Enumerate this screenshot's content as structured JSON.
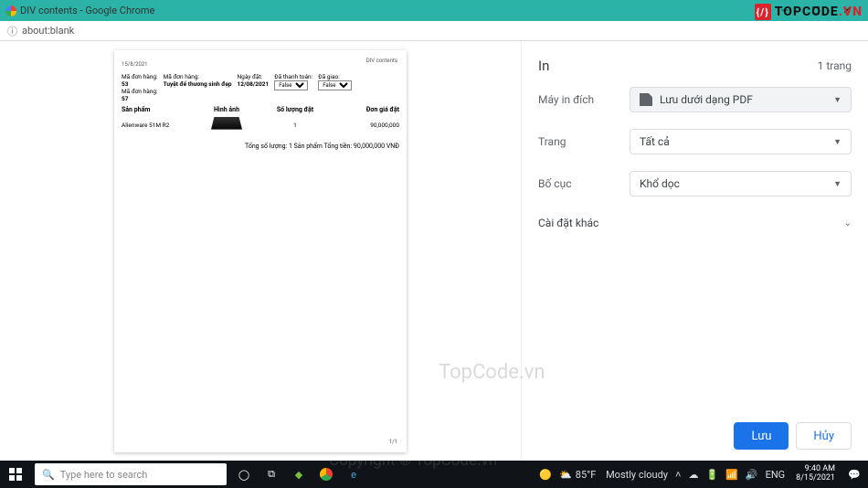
{
  "window": {
    "title": "DIV contents - Google Chrome"
  },
  "addr": {
    "url": "about:blank"
  },
  "logo": {
    "mark": "{/}",
    "a": "TOPCODE",
    "b": ".VN"
  },
  "bg": {
    "line1a": "Mã đơn hàng: ",
    "id1": "53",
    "line1b": " Mã đơn hàng: ",
    "id2": "57",
    "tail": " N",
    "line2": "Sản phẩm",
    "product": "Alienware 51M R2"
  },
  "doc": {
    "topdate": "15/8/2021",
    "corner": "DIV contents",
    "c1l": "Mã đơn hàng:",
    "c1v": "53",
    "c1l2": "Mã đơn hàng:",
    "c1v2": "57",
    "c2l": "Mã đơn hàng:",
    "c2v": "Tuyệt để thương sinh đẹp",
    "c3l": "Ngày đặt:",
    "c3v": "12/08/2021",
    "c4l": "Đã thanh toán:",
    "c4v": "False",
    "c5l": "Đã giao:",
    "c5v": "False",
    "h1": "Sản phẩm",
    "h2": "Hình ảnh",
    "h3": "Số lượng đặt",
    "h4": "Đơn giá đặt",
    "r1": "Alienware 51M R2",
    "r3": "1",
    "r4": "90,000,000",
    "total": "Tổng số lượng: 1 Sản phẩm Tổng tiền: 90,000,000 VNĐ",
    "pgno": "1/1"
  },
  "print": {
    "title": "In",
    "pages": "1 trang",
    "dest_lbl": "Máy in đích",
    "dest_val": "Lưu dưới dạng PDF",
    "pages_lbl": "Trang",
    "pages_val": "Tất cả",
    "layout_lbl": "Bố cục",
    "layout_val": "Khổ dọc",
    "more": "Cài đặt khác",
    "save": "Lưu",
    "cancel": "Hủy"
  },
  "taskbar": {
    "search_placeholder": "Type here to search",
    "weather_temp": "85°F",
    "weather_txt": "Mostly cloudy",
    "lang": "ENG",
    "time": "9:40 AM",
    "date": "8/15/2021"
  },
  "wm": {
    "a": "TopCode.vn",
    "b": "Copyright © TopCode.vn"
  }
}
